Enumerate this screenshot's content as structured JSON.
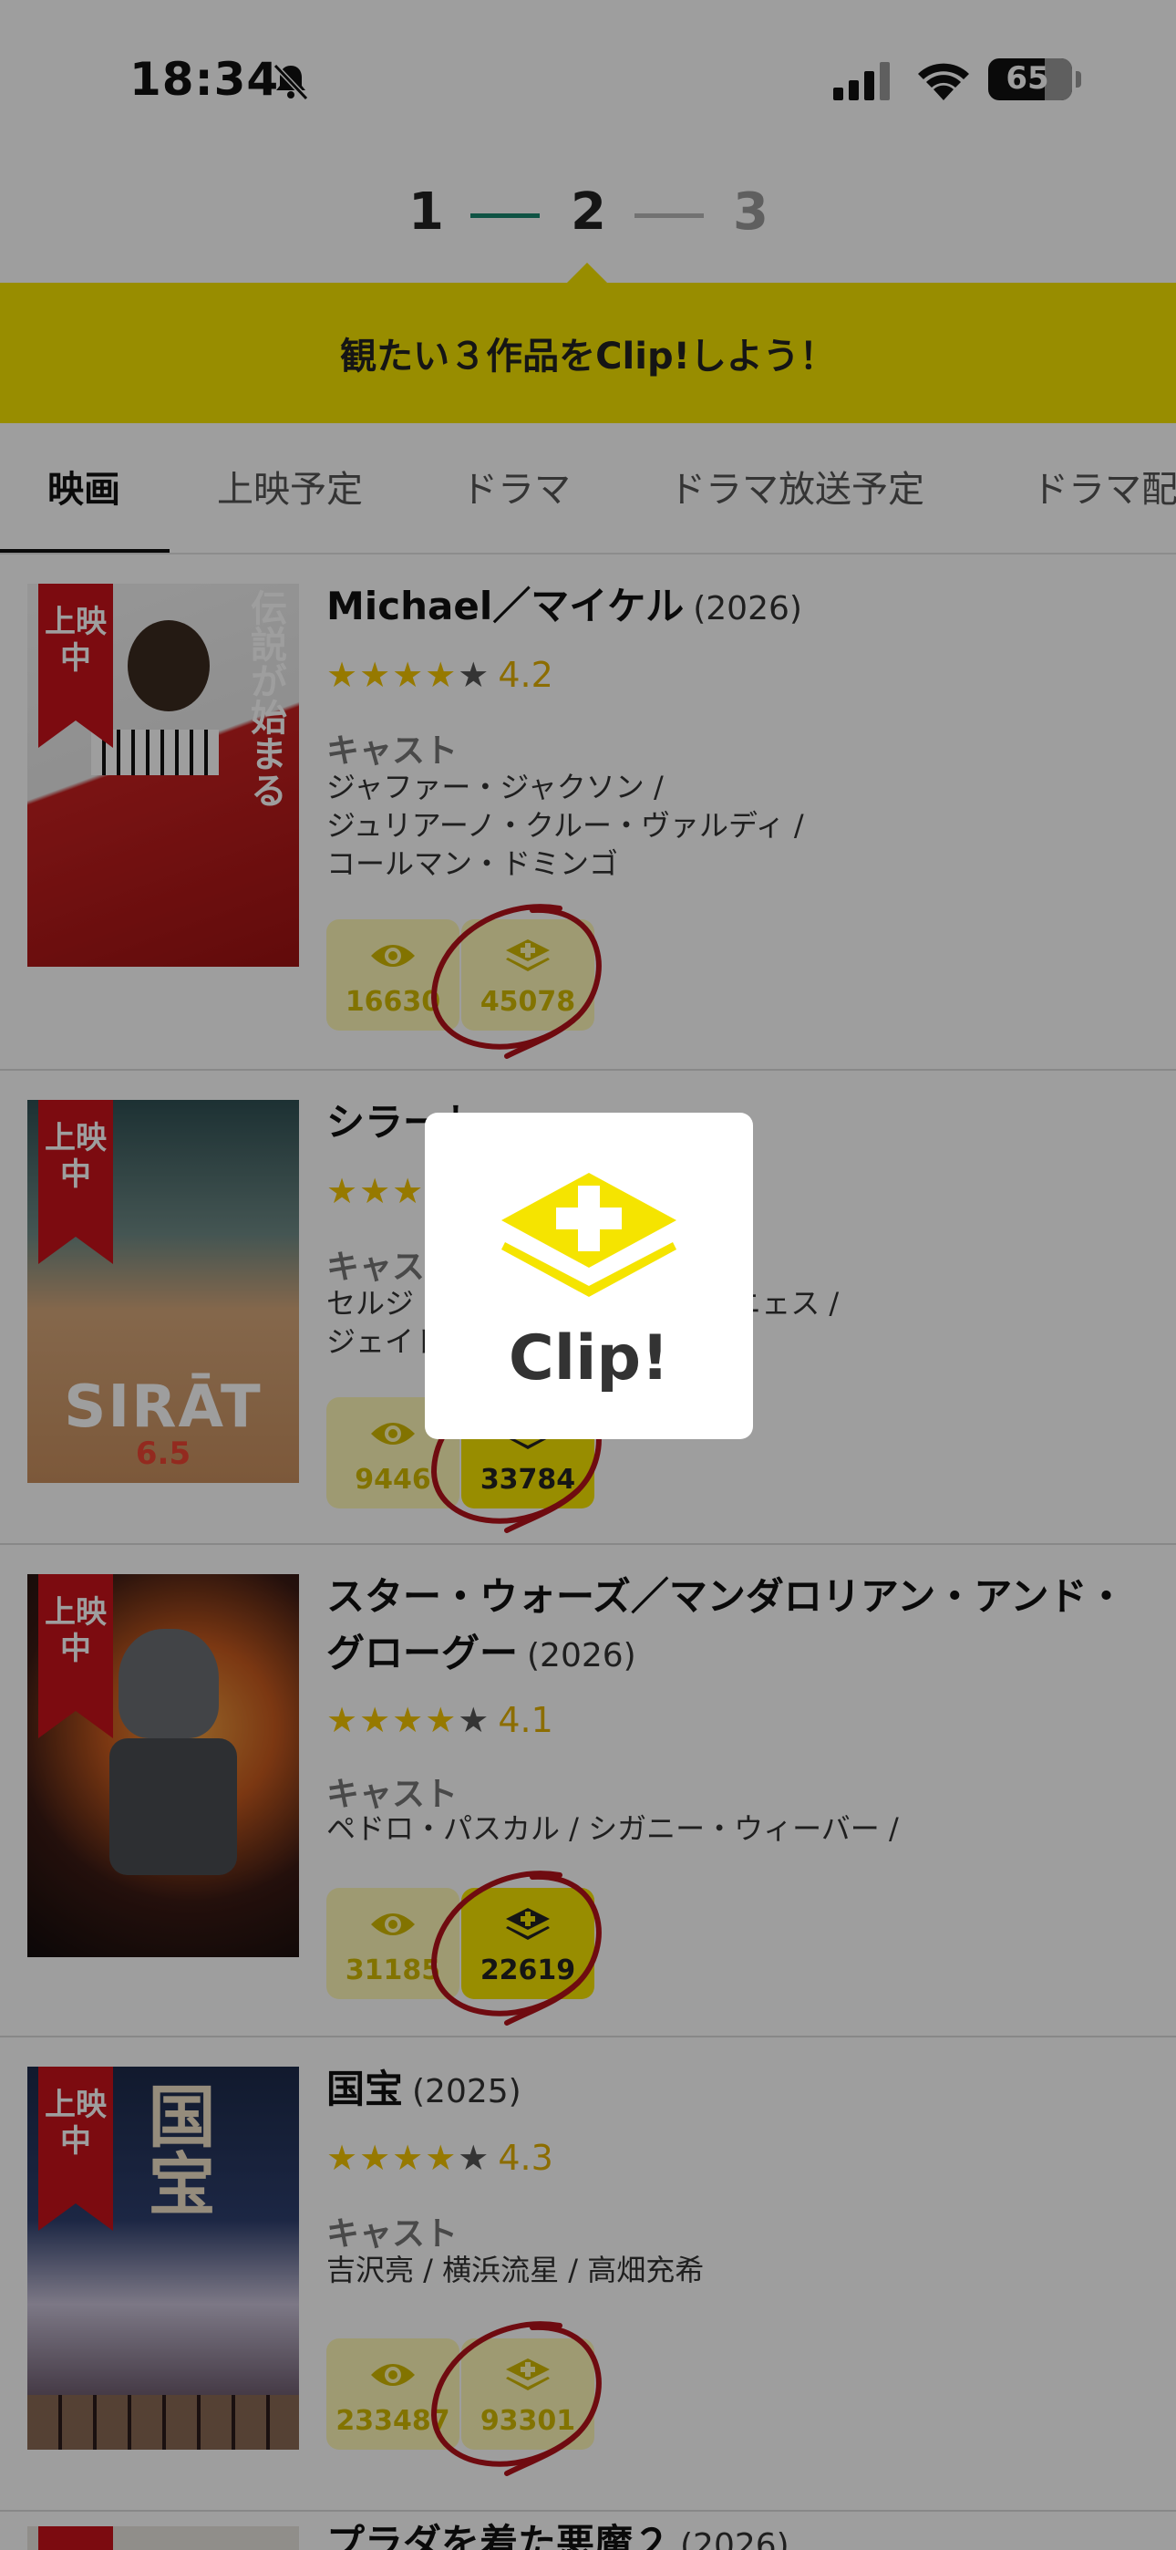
{
  "status_bar": {
    "time": "18:34",
    "battery": "65"
  },
  "steps": {
    "one": "1",
    "two": "2",
    "three": "3"
  },
  "banner": {
    "text": "観たい３作品をClip!しよう！"
  },
  "tabs": [
    "映画",
    "上映予定",
    "ドラマ",
    "ドラマ放送予定",
    "ドラマ配"
  ],
  "ribbon_label": "上映中",
  "cast_label": "キャスト",
  "movies": [
    {
      "title": "Michael／マイケル",
      "year": "(2026)",
      "stars_on": 4,
      "score": "4.2",
      "cast": [
        "ジャファー・ジャクソン /",
        "ジュリアーノ・クルー・ヴァルディ /",
        "コールマン・ドミンゴ"
      ],
      "views": "16630",
      "clips": "45078",
      "clipped": false
    },
    {
      "title": "シラート",
      "year": "",
      "stars_on": 4,
      "score": "",
      "cast": [
        "セルジ・ロペス / ブルーノ・ヌニェス /",
        "ジェイド"
      ],
      "views": "9446",
      "clips": "33784",
      "clipped": true
    },
    {
      "title": "スター・ウォーズ／マンダロリアン・アンド・グローグー",
      "year": "(2026)",
      "stars_on": 4,
      "score": "4.1",
      "cast": [
        "ペドロ・パスカル / シガニー・ウィーバー /"
      ],
      "views": "31185",
      "clips": "22619",
      "clipped": true
    },
    {
      "title": "国宝",
      "year": "(2025)",
      "stars_on": 4,
      "score": "4.3",
      "cast": [
        "吉沢亮 / 横浜流星 / 高畑充希"
      ],
      "views": "233487",
      "clips": "93301",
      "clipped": false
    },
    {
      "title": "プラダを着た悪魔２",
      "year": "(2026)"
    }
  ],
  "poster_text": {
    "m1": "伝説が始まる",
    "m2": "SIRĀT",
    "m2_date": "6.5",
    "m4": "国宝"
  },
  "popup": {
    "label": "Clip!"
  },
  "colors": {
    "accent": "#f5e400",
    "ribbon": "#c8121a",
    "step_active": "#19866f",
    "annotation": "#b3121a"
  }
}
